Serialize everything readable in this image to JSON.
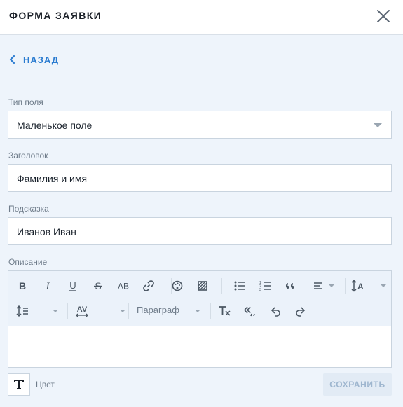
{
  "header": {
    "title": "ФОРМА ЗАЯВКИ",
    "close_icon": "close-icon"
  },
  "back": {
    "label": "НАЗАД",
    "icon": "chevron-left-icon"
  },
  "fields": {
    "type": {
      "label": "Тип поля",
      "value": "Маленькое поле"
    },
    "heading": {
      "label": "Заголовок",
      "value": "Фамилия и имя"
    },
    "hint": {
      "label": "Подсказка",
      "value": "Иванов Иван"
    },
    "description": {
      "label": "Описание",
      "value": ""
    }
  },
  "toolbar": {
    "paragraph_label": "Параграф",
    "row1_icons": [
      "bold-icon",
      "italic-icon",
      "underline-icon",
      "strikethrough-icon",
      "uppercase-icon",
      "link-icon",
      "palette-icon",
      "background-icon",
      "bullet-list-icon",
      "numbered-list-icon",
      "blockquote-icon",
      "align-icon",
      "font-size-icon"
    ],
    "row2_icons": [
      "line-height-icon",
      "letter-spacing-icon",
      "clear-format-icon",
      "quotes-icon",
      "undo-icon",
      "redo-icon"
    ]
  },
  "footer": {
    "color_label": "Цвет",
    "save_label": "СОХРАНИТЬ"
  },
  "colors": {
    "accent": "#2a7bd0",
    "background": "#eef4fb",
    "border": "#c9d4df",
    "save_disabled_text": "#9eb6cf"
  }
}
